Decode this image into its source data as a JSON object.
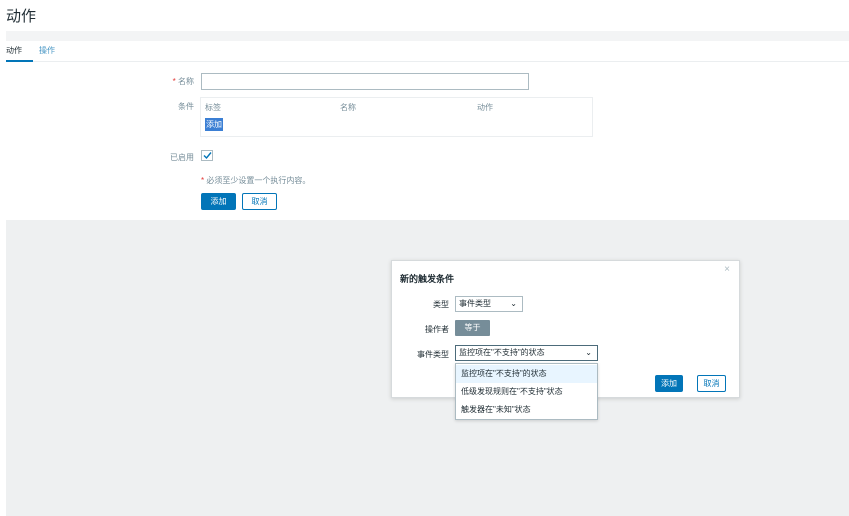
{
  "page": {
    "title": "动作"
  },
  "tabs": [
    "动作",
    "操作"
  ],
  "form": {
    "name_label": "名称",
    "name_value": "",
    "conditions_label": "条件",
    "conditions_columns": [
      "标签",
      "名称",
      "动作"
    ],
    "conditions_add": "添加",
    "enabled_label": "已启用",
    "enabled_checked": true,
    "hint": "必须至少设置一个执行内容。",
    "required_mark": "*",
    "add_button": "添加",
    "cancel_button": "取消"
  },
  "dialog": {
    "title": "新的触发条件",
    "close": "×",
    "type_label": "类型",
    "type_value": "事件类型",
    "operator_label": "操作者",
    "operator_value": "等于",
    "event_type_label": "事件类型",
    "event_type_value": "监控项在\"不支持\"的状态",
    "event_type_options": [
      "监控项在\"不支持\"的状态",
      "低级发现规则在\"不支持\"状态",
      "触发器在\"未知\"状态"
    ],
    "highlighted_option_index": 0,
    "add_button": "添加",
    "cancel_button": "取消"
  },
  "colors": {
    "primary": "#0275b8",
    "link": "#4796c4",
    "overlay": "#eef0f1",
    "required": "#e33734"
  }
}
